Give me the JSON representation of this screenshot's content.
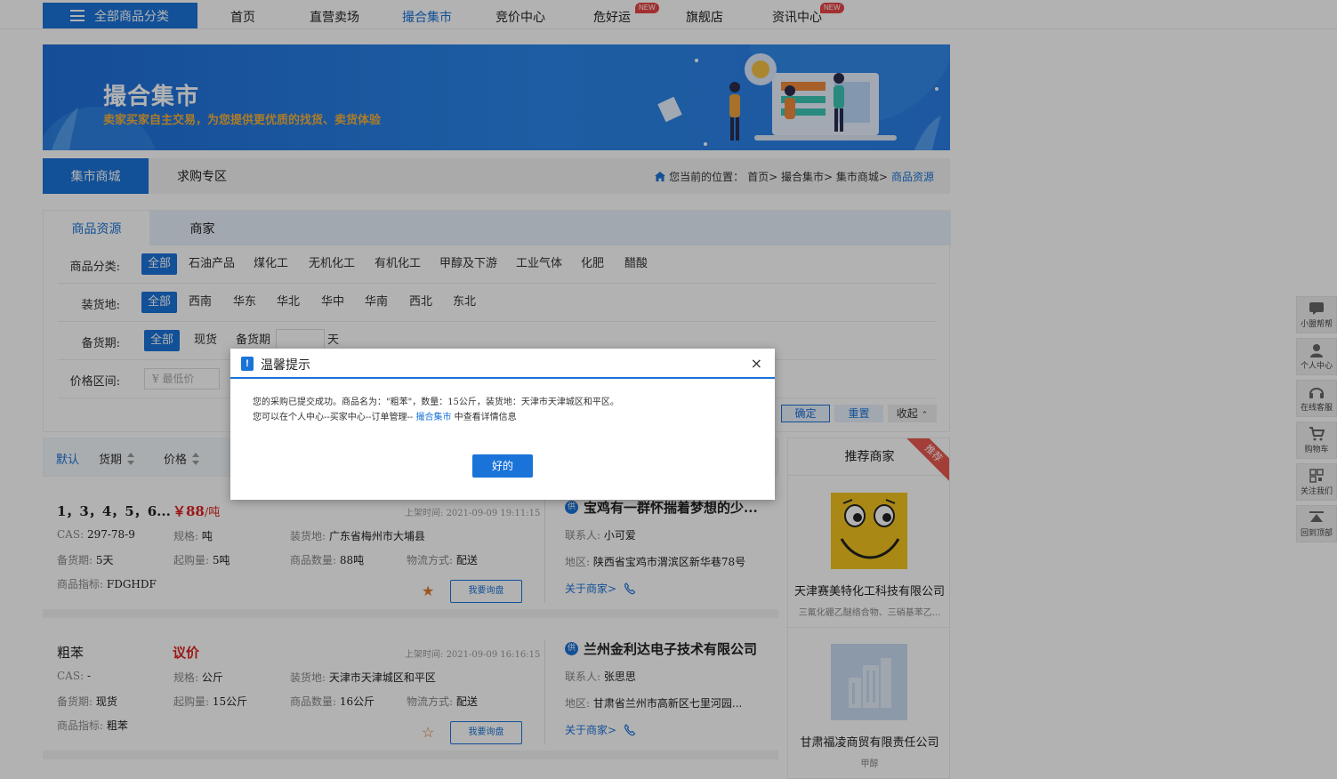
{
  "nav": {
    "all_categories": "全部商品分类",
    "links": [
      "首页",
      "直营卖场",
      "撮合集市",
      "竞价中心",
      "危好运",
      "旗舰店",
      "资讯中心"
    ],
    "active_link": "撮合集市",
    "new_badge": "NEW"
  },
  "banner": {
    "title": "撮合集市",
    "subtitle": "卖家买家自主交易，为您提供更优质的找货、卖货体验"
  },
  "tabs": {
    "market": "集市商城",
    "purchase": "求购专区"
  },
  "breadcrumb": {
    "prefix": "您当前的位置：",
    "path": "首页> 撮合集市> 集市商城>",
    "current": "商品资源"
  },
  "filter": {
    "tabs": [
      "商品资源",
      "商家"
    ],
    "category_label": "商品分类:",
    "categories": [
      "全部",
      "石油产品",
      "煤化工",
      "无机化工",
      "有机化工",
      "甲醇及下游",
      "工业气体",
      "化肥",
      "醋酸"
    ],
    "loading_label": "装货地:",
    "regions": [
      "全部",
      "西南",
      "华东",
      "华北",
      "华中",
      "华南",
      "西北",
      "东北"
    ],
    "stock_label": "备货期:",
    "stock_options": [
      "全部",
      "现货",
      "备货期"
    ],
    "stock_unit": "天",
    "price_label": "价格区间:",
    "price_min_placeholder": "¥ 最低价",
    "confirm": "确定",
    "reset": "重置",
    "fold": "收起"
  },
  "sortbar": {
    "default": "默认",
    "stock": "货期",
    "price": "价格"
  },
  "labels": {
    "cas": "CAS:",
    "spec": "规格:",
    "loading": "装货地:",
    "stock": "备货期:",
    "min_qty": "起购量:",
    "qty": "商品数量:",
    "logistics": "物流方式:",
    "indicator": "商品指标:",
    "uptime": "上架时间:",
    "contact": "联系人:",
    "area": "地区:",
    "inquire": "我要询盘",
    "about": "关于商家>"
  },
  "products": [
    {
      "name": "1，3，4，5，6...",
      "price": "￥88",
      "unit": "/吨",
      "uptime": "2021-09-09 19:11:15",
      "cas": "297-78-9",
      "spec": "吨",
      "loading": "广东省梅州市大埔县",
      "stock": "5天",
      "min_qty": "5吨",
      "qty": "88吨",
      "logistics": "配送",
      "indicator": "FDGHDF",
      "starred": true,
      "seller": "宝鸡有一群怀揣着梦想的少...",
      "contact": "小可爱",
      "area": "陕西省宝鸡市渭滨区新华巷78号"
    },
    {
      "name": "粗苯",
      "price": "议价",
      "unit": "",
      "uptime": "2021-09-09 16:16:15",
      "cas": "-",
      "spec": "公斤",
      "loading": "天津市天津城区和平区",
      "stock": "现货",
      "min_qty": "15公斤",
      "qty": "16公斤",
      "logistics": "配送",
      "indicator": "粗苯",
      "starred": false,
      "seller": "兰州金利达电子技术有限公司",
      "contact": "张思思",
      "area": "甘肃省兰州市高新区七里河园..."
    }
  ],
  "supply_badge": "供",
  "recommend": {
    "title": "推荐商家",
    "ribbon": "推荐",
    "items": [
      {
        "name": "天津赛美特化工科技有限公司",
        "desc": "三氟化硼乙醚络合物、三硝基苯乙..."
      },
      {
        "name": "甘肃福凌商贸有限责任公司",
        "desc": "甲醇"
      }
    ]
  },
  "floatbar": [
    "小盟帮帮",
    "个人中心",
    "在线客服",
    "购物车",
    "关注我们",
    "回到顶部"
  ],
  "modal": {
    "title": "温馨提示",
    "close": "×",
    "line1": "您的采购已提交成功。商品名为：\"粗苯\"，数量：15公斤，装货地：天津市天津城区和平区。",
    "line2_prefix": "您可以在个人中心--买家中心--订单管理--",
    "line2_link": "撮合集市",
    "line2_suffix": " 中查看详情信息",
    "ok": "好的"
  },
  "colors": {
    "primary": "#1a73d9",
    "price_red": "#e02020",
    "banner_accent": "#f7b23a",
    "ribbon": "#e85a4f"
  }
}
